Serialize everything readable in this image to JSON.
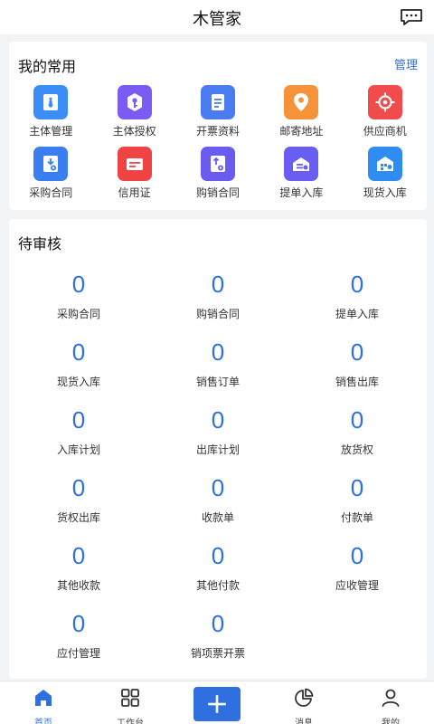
{
  "header": {
    "title": "木管家",
    "message_icon": "message-icon"
  },
  "common": {
    "title": "我的常用",
    "manage_label": "管理",
    "apps": [
      {
        "label": "主体管理",
        "icon": "tie-icon",
        "color": "#3a8ef6"
      },
      {
        "label": "主体授权",
        "icon": "key-icon",
        "color": "#7b5bf2"
      },
      {
        "label": "开票资料",
        "icon": "document-icon",
        "color": "#4a7bf0"
      },
      {
        "label": "邮寄地址",
        "icon": "location-pin-icon",
        "color": "#f5923a"
      },
      {
        "label": "供应商机",
        "icon": "target-icon",
        "color": "#f24b4b"
      },
      {
        "label": "采购合同",
        "icon": "purchase-contract-icon",
        "color": "#3a7ef0"
      },
      {
        "label": "信用证",
        "icon": "credit-card-icon",
        "color": "#f04444"
      },
      {
        "label": "购销合同",
        "icon": "sales-contract-icon",
        "color": "#6b5cf0"
      },
      {
        "label": "提单入库",
        "icon": "truck-in-icon",
        "color": "#6a5ef2"
      },
      {
        "label": "现货入库",
        "icon": "warehouse-icon",
        "color": "#2f8cf0"
      }
    ]
  },
  "pending": {
    "title": "待审核",
    "items": [
      {
        "count": "0",
        "name": "采购合同"
      },
      {
        "count": "0",
        "name": "购销合同"
      },
      {
        "count": "0",
        "name": "提单入库"
      },
      {
        "count": "0",
        "name": "现货入库"
      },
      {
        "count": "0",
        "name": "销售订单"
      },
      {
        "count": "0",
        "name": "销售出库"
      },
      {
        "count": "0",
        "name": "入库计划"
      },
      {
        "count": "0",
        "name": "出库计划"
      },
      {
        "count": "0",
        "name": "放货权"
      },
      {
        "count": "0",
        "name": "货权出库"
      },
      {
        "count": "0",
        "name": "收款单"
      },
      {
        "count": "0",
        "name": "付款单"
      },
      {
        "count": "0",
        "name": "其他收款"
      },
      {
        "count": "0",
        "name": "其他付款"
      },
      {
        "count": "0",
        "name": "应收管理"
      },
      {
        "count": "0",
        "name": "应付管理"
      },
      {
        "count": "0",
        "name": "销项票开票"
      }
    ]
  },
  "tabbar": {
    "items": [
      {
        "label": "首页",
        "icon": "home-icon",
        "active": true
      },
      {
        "label": "工作台",
        "icon": "grid-icon",
        "active": false
      },
      {
        "label": "",
        "icon": "plus-icon",
        "active": false
      },
      {
        "label": "消息",
        "icon": "pie-chart-icon",
        "active": false
      },
      {
        "label": "我的",
        "icon": "user-icon",
        "active": false
      }
    ]
  },
  "colors": {
    "accent": "#2f6fe0",
    "background": "#f2f3f5"
  }
}
